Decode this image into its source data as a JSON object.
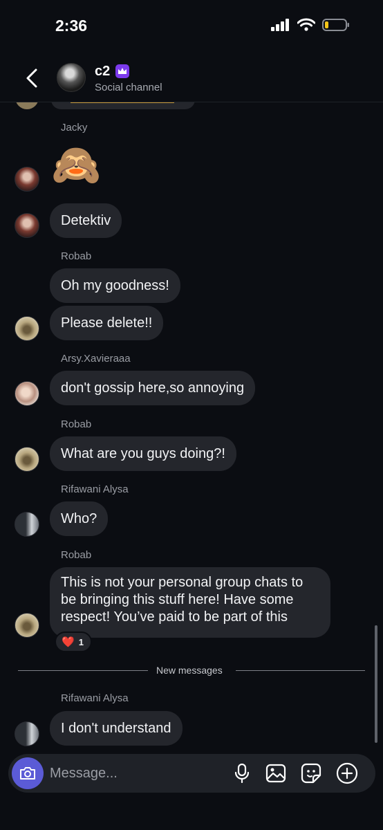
{
  "status_bar": {
    "time": "2:36"
  },
  "header": {
    "title": "c2",
    "subtitle": "Social channel"
  },
  "messages": {
    "jacky_name": "Jacky",
    "jacky_emoji": "🙈",
    "jacky_text": "Detektiv",
    "robab_name_1": "Robab",
    "robab_text_1": "Oh my goodness!",
    "robab_text_2": "Please delete!!",
    "arsy_name": "Arsy.Xavieraaa",
    "arsy_text": "don't gossip here,so annoying",
    "robab_name_2": "Robab",
    "robab_text_3": "What are you guys doing?!",
    "rifa_name_1": "Rifawani Alysa",
    "rifa_text_1": "Who?",
    "robab_name_3": "Robab",
    "robab_text_4": "This is not your personal group chats to be bringing this stuff here! Have some respect! You’ve paid to be part of this",
    "reaction_emoji": "❤️",
    "reaction_count": "1",
    "new_messages_label": "New messages",
    "rifa_name_2": "Rifawani Alysa",
    "rifa_text_2": "I don't understand"
  },
  "composer": {
    "placeholder": "Message..."
  },
  "icons": {
    "back": "chevron-left-icon",
    "crown": "crown-icon",
    "camera": "camera-icon",
    "mic": "microphone-icon",
    "gallery": "image-icon",
    "sticker": "sticker-icon",
    "more": "plus-circle-icon"
  },
  "colors": {
    "background": "#0b0d12",
    "bubble": "#24262c",
    "accent": "#5b5bd6",
    "badge": "#7c3aed"
  }
}
